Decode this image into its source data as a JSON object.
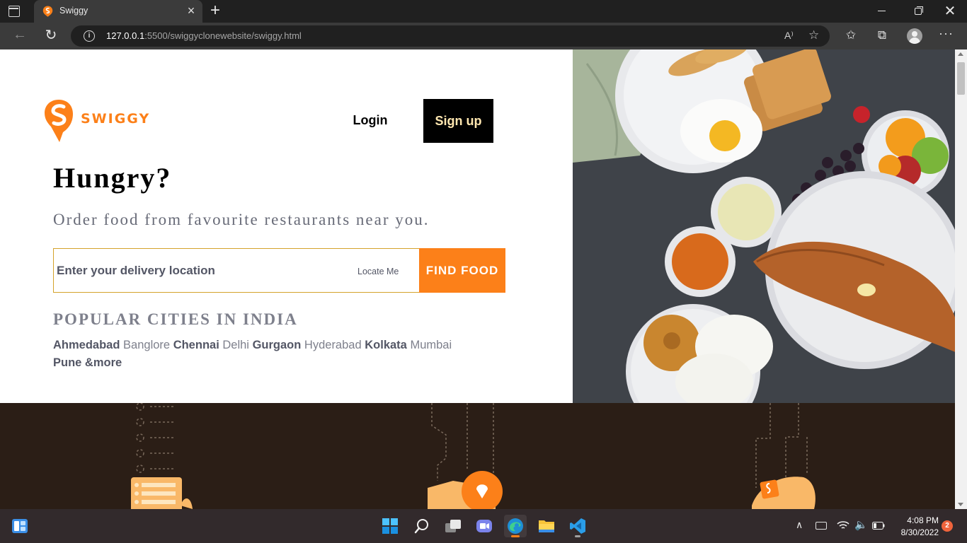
{
  "browser": {
    "tab_title": "Swiggy",
    "tab_close": "×",
    "new_tab": "+",
    "url_host": "127.0.0.1",
    "url_path": ":5500/swiggyclonewebsite/swiggy.html",
    "read_aloud": "A⁾",
    "menu": "···"
  },
  "header": {
    "logo_text": "SWIGGY",
    "login_label": "Login",
    "signup_label": "Sign up"
  },
  "hero": {
    "title": "Hungry?",
    "subtitle": "Order food from favourite restaurants near you.",
    "search_placeholder": "Enter your delivery location",
    "locate_me": "Locate Me",
    "find_food": "FIND FOOD"
  },
  "popular": {
    "title": "POPULAR CITIES IN INDIA",
    "cities": [
      {
        "name": "Ahmedabad",
        "bold": true
      },
      {
        "name": "Banglore",
        "bold": false
      },
      {
        "name": "Chennai",
        "bold": true
      },
      {
        "name": "Delhi",
        "bold": false
      },
      {
        "name": "Gurgaon",
        "bold": true
      },
      {
        "name": "Hyderabad",
        "bold": false
      },
      {
        "name": "Kolkata",
        "bold": true
      },
      {
        "name": "Mumbai",
        "bold": false
      },
      {
        "name": "Pune &more",
        "bold": true
      }
    ]
  },
  "taskbar": {
    "time": "4:08 PM",
    "date": "8/30/2022",
    "notifications": "2"
  },
  "colors": {
    "brand": "#fc8019",
    "band": "#2b1e16",
    "signup_text": "#ffe7b0"
  }
}
